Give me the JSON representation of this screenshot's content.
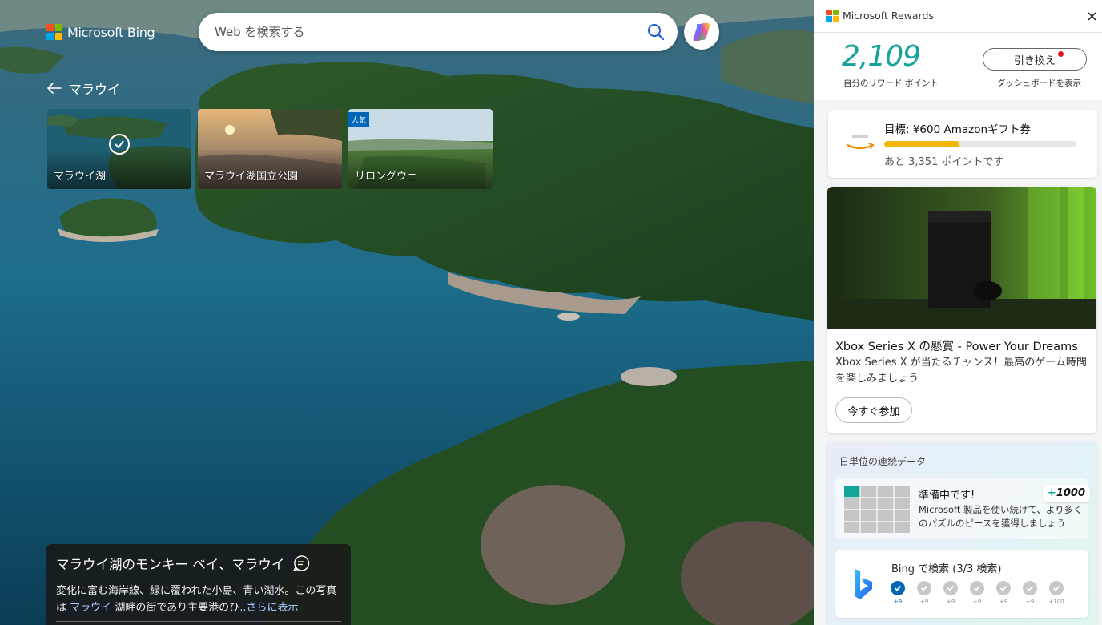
{
  "brand": {
    "name": "Microsoft Bing",
    "logo_colors": [
      "#f25022",
      "#7fba00",
      "#00a4ef",
      "#ffb900"
    ]
  },
  "search": {
    "placeholder": "Web を検索する"
  },
  "breadcrumb": {
    "label": "マラウイ"
  },
  "cards": [
    {
      "label": "マラウイ湖",
      "selected": true
    },
    {
      "label": "マラウイ湖国立公園",
      "selected": false
    },
    {
      "label": "リロングウェ",
      "badge": "人気",
      "selected": false
    }
  ],
  "caption": {
    "title": "マラウイ湖のモンキー ベイ、マラウイ",
    "text_line1": "変化に富む海岸線、緑に覆われた小島、青い湖水。この写真",
    "text_prefix": "は",
    "text_link": "マラウイ",
    "text_middle": "湖畔の街であり主要港のひ",
    "text_more": "..さらに表示"
  },
  "rewards": {
    "header": "Microsoft Rewards",
    "close": "×",
    "points": "2,109",
    "points_label": "自分のリワード ポイント",
    "redeem_label": "引き換え",
    "dashboard_label": "ダッシュボードを表示",
    "goal": {
      "title": "目標: ¥600 Amazonギフト券",
      "progress_fraction": 0.39,
      "remaining": "あと 3,351 ポイントです"
    },
    "promo": {
      "title": "Xbox Series X の懸賞 - Power Your Dreams",
      "description": "Xbox Series X が当たるチャンス！最高のゲーム時間を楽しみましょう",
      "button": "今すぐ参加"
    },
    "streak": {
      "title": "日単位の連続データ",
      "puzzle_title": "準備中です!",
      "puzzle_desc": "Microsoft 製品を使い続けて、より多くのパズルのピースを獲得しましょう",
      "puzzle_badge": "1000",
      "search_title": "Bing で検索 (3/3 検索)",
      "ticks": [
        {
          "points": "+9",
          "done": true
        },
        {
          "points": "+9",
          "done": false
        },
        {
          "points": "+9",
          "done": false
        },
        {
          "points": "+9",
          "done": false
        },
        {
          "points": "+9",
          "done": false
        },
        {
          "points": "+9",
          "done": false
        },
        {
          "points": "+100",
          "done": false
        }
      ]
    }
  },
  "colors": {
    "accent_teal": "#12a39a",
    "progress_yellow": "#f2b705",
    "bing_blue": "#0067b8",
    "notification_red": "#e81123"
  }
}
